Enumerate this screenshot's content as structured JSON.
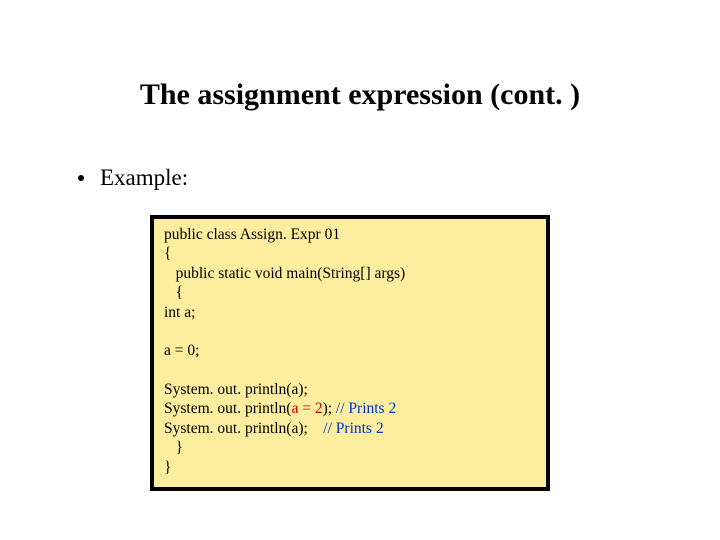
{
  "title": "The assignment expression (cont. )",
  "bullet": {
    "label": "Example:"
  },
  "code": {
    "l1a": "public class Assign. Expr 01",
    "l2": "{",
    "l3": "   public static void main(String[] args)",
    "l4": "   {",
    "l5": "int a;",
    "blank1": "",
    "l6": "a = 0;",
    "blank2": "",
    "l7": "System. out. println(a);",
    "l8a": "System. out. println(",
    "l8b": "a = 2",
    "l8c": "); ",
    "l8d": "// Prints 2",
    "l9a": "System. out. println(a);    ",
    "l9b": "// Prints 2",
    "l10": "   }",
    "l11": "}"
  }
}
